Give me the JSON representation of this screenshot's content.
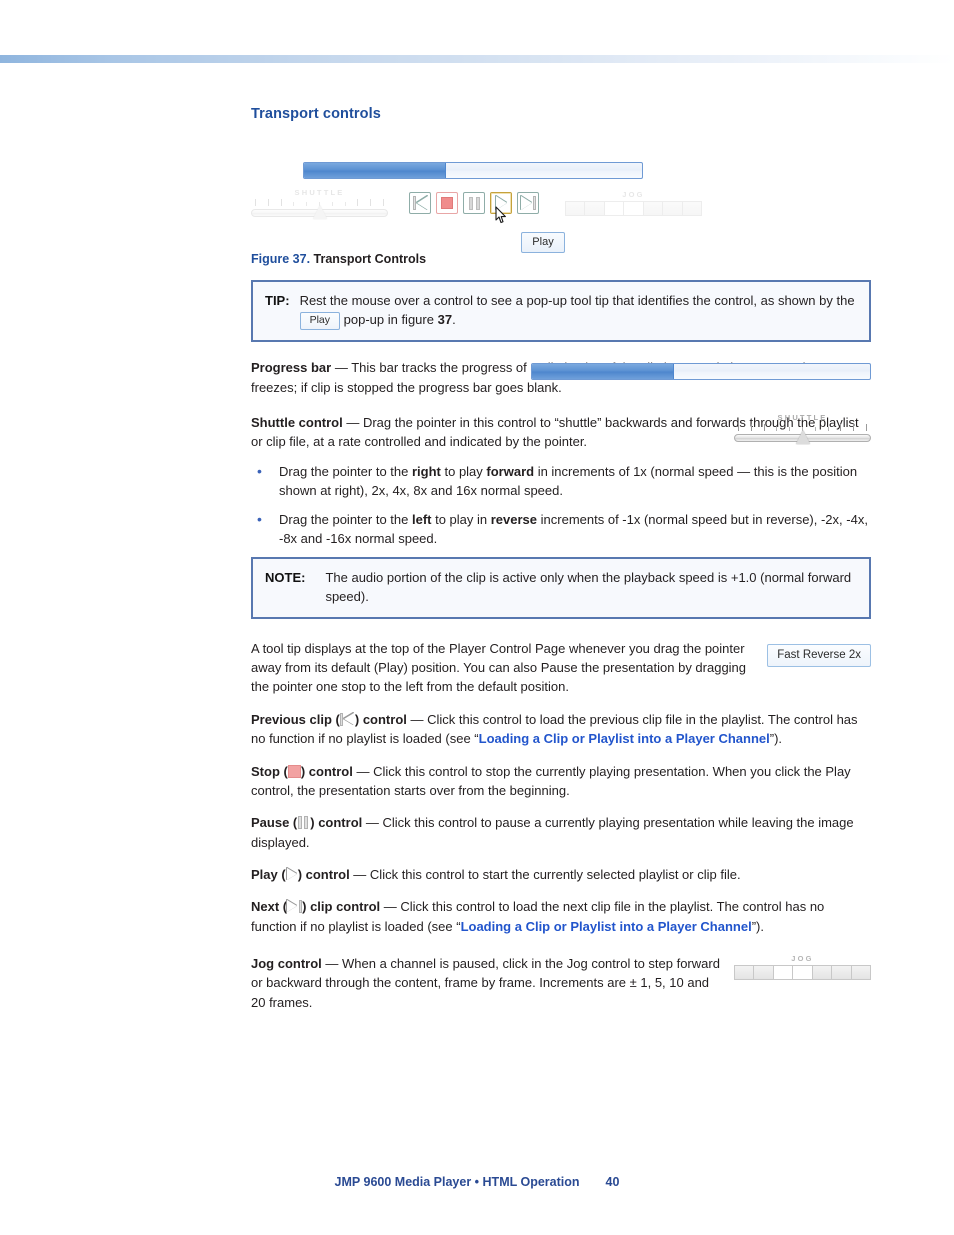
{
  "section": {
    "title": "Transport controls"
  },
  "figure": {
    "caption_number": "Figure 37.",
    "caption_text": "Transport Controls",
    "progress_fill_percent": 42,
    "shuttle_label": "SHUTTLE",
    "jog_label": "JOG",
    "tooltip": "Play",
    "buttons": [
      {
        "name": "previous-clip",
        "icon": "previous-clip-icon"
      },
      {
        "name": "stop",
        "icon": "stop-icon"
      },
      {
        "name": "pause",
        "icon": "pause-icon"
      },
      {
        "name": "play",
        "icon": "play-icon"
      },
      {
        "name": "next-clip",
        "icon": "next-clip-icon"
      }
    ]
  },
  "tip_box": {
    "keyword": "TIP:",
    "text_before": "Rest the mouse over a control to see a pop-up tool tip that identifies the control, as shown by the",
    "chip": "Play",
    "text_after_a": "pop-up in figure",
    "figure_ref": "37",
    "text_after_b": "."
  },
  "progress_bar_para": {
    "heading": "Progress bar",
    "dash": " — ",
    "text": "This bar tracks the progress of a clip in play. If the clip is paused, the progress bar freezes; if clip is stopped the progress bar goes blank.",
    "fill_percent": 42
  },
  "shuttle_para": {
    "heading": "Shuttle control",
    "dash": " — ",
    "text": "Drag the pointer in this control to “shuttle” backwards and forwards through the playlist or clip file, at a rate controlled and indicated by the pointer.",
    "widget_label": "SHUTTLE"
  },
  "shuttle_bullets": [
    {
      "p1": "Drag the pointer to the ",
      "b1": "right",
      "p2": " to play ",
      "b2": "forward",
      "p3": " in increments of 1x (normal speed — this is the position shown at right), 2x, 4x, 8x and 16x normal speed."
    },
    {
      "p1": "Drag the pointer to the ",
      "b1": "left",
      "p2": " to play in ",
      "b2": "reverse",
      "p3": " increments of -1x (normal speed but in reverse), -2x, -4x, -8x and -16x normal speed."
    }
  ],
  "note_box": {
    "keyword": "NOTE:",
    "text": "The audio portion of the clip is active only when the playback speed is +1.0 (normal forward speed)."
  },
  "tooltip_para": {
    "text": "A tool tip displays at the top of the Player Control Page whenever you drag the pointer away from its default (Play) position. You can also Pause the presentation by dragging the pointer one stop to the left from the default position.",
    "chip": "Fast Reverse 2x"
  },
  "controls": {
    "previous_clip": {
      "heading_a": "Previous clip (",
      "heading_b": ") control",
      "dash": " — ",
      "text_a": "Click this control to load the previous clip file in the playlist. The control has no function if no playlist is loaded (see “",
      "link": "Loading a Clip or Playlist into a Player Channel",
      "text_b": "”)."
    },
    "stop": {
      "heading_a": "Stop (",
      "heading_b": ") control",
      "dash": " — ",
      "text": "Click this control to stop the currently playing presentation. When you click the Play control, the presentation starts over from the beginning."
    },
    "pause": {
      "heading_a": "Pause (",
      "heading_b": ") control",
      "dash": " — ",
      "text": "Click this control to pause a currently playing presentation while leaving the image displayed."
    },
    "play": {
      "heading_a": "Play (",
      "heading_b": ") control",
      "dash": " — ",
      "text": "Click this control to start the currently selected playlist or clip file."
    },
    "next": {
      "heading_a": "Next (",
      "heading_b": ") clip control",
      "dash": " — ",
      "text_a": "Click this control to load the next clip file in the playlist. The control has no function if no playlist is loaded (see “",
      "link": "Loading a Clip or Playlist into a Player Channel",
      "text_b": "”)."
    },
    "jog": {
      "heading": "Jog control",
      "dash": " — ",
      "text": "When a channel is paused, click in the Jog control to step forward or backward through the content, frame by frame. Increments are ± 1, 5, 10 and 20 frames.",
      "widget_label": "JOG"
    }
  },
  "footer": {
    "doc_title": "JMP 9600 Media Player • HTML Operation",
    "page_number": "40"
  },
  "colors": {
    "heading_blue": "#1f4e9c",
    "link_blue": "#2255cc",
    "callout_border": "#5878b0",
    "progress_fill": "#5a90d2",
    "footer_blue": "#2a4a93"
  }
}
